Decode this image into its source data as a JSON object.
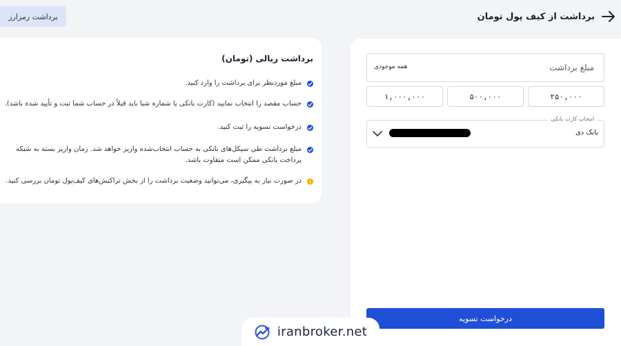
{
  "header": {
    "title": "برداشت از کیف پول تومان",
    "back_icon": "arrow-right-icon"
  },
  "crypto_button": {
    "label": "برداشت رمزارز"
  },
  "form": {
    "amount": {
      "placeholder": "مبلغ برداشت",
      "all_balance_label": "همه موجودی"
    },
    "presets": [
      "۲۵۰,۰۰۰",
      "۵۰۰,۰۰۰",
      "۱,۰۰۰,۰۰۰"
    ],
    "bank_select": {
      "label": "انتخاب کارت بانکی",
      "value": "بانک دی",
      "icon": "chevron-down-icon"
    },
    "submit_label": "درخواست تسویه"
  },
  "info": {
    "title": "برداشت ریالی (تومان)",
    "items": [
      {
        "text": "مبلغ موردنظر برای برداشت را وارد کنید.",
        "color": "#1f4fd6"
      },
      {
        "text": "حساب مقصد را انتخاب نمایید (کارت بانکی یا شماره شبا باید قبلاً در حساب شما ثبت و تأیید شده باشد).",
        "color": "#1f4fd6"
      },
      {
        "text": "درخواست تسویه را ثبت کنید.",
        "color": "#1f4fd6"
      },
      {
        "text": "مبلغ برداشت طی سیکل‌های بانکی به حساب انتخاب‌شده واریز خواهد شد. زمان واریز بسته به شبکه پرداخت بانکی ممکن است متفاوت باشد.",
        "color": "#1f4fd6"
      },
      {
        "text": "در صورت نیاز به پیگیری، می‌توانید وضعیت برداشت را از بخش تراکنش‌های کیف‌پول تومان بررسی کنید.",
        "color": "#f6b100"
      }
    ]
  },
  "watermark": {
    "text": "iranbroker.net"
  },
  "colors": {
    "primary": "#1f4fd6",
    "accent_soft": "#dfe3f8",
    "warning": "#f6b100"
  }
}
